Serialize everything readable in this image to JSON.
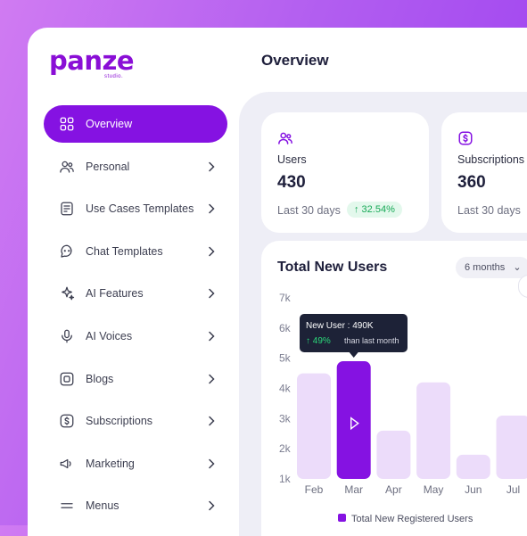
{
  "brand": {
    "logo": "panze",
    "sub": "studio."
  },
  "header": {
    "title": "Overview"
  },
  "sidebar": {
    "items": [
      {
        "label": "Overview",
        "icon": "grid-icon",
        "active": true
      },
      {
        "label": "Personal",
        "icon": "users-icon"
      },
      {
        "label": "Use Cases Templates",
        "icon": "template-icon"
      },
      {
        "label": "Chat Templates",
        "icon": "chat-icon"
      },
      {
        "label": "AI Features",
        "icon": "sparkle-icon"
      },
      {
        "label": "AI Voices",
        "icon": "microphone-icon"
      },
      {
        "label": "Blogs",
        "icon": "blog-icon"
      },
      {
        "label": "Subscriptions",
        "icon": "dollar-icon"
      },
      {
        "label": "Marketing",
        "icon": "megaphone-icon"
      },
      {
        "label": "Menus",
        "icon": "menu-icon"
      }
    ]
  },
  "stats": [
    {
      "label": "Users",
      "value": "430",
      "period": "Last 30 days",
      "change": "↑ 32.54%",
      "icon": "users-icon"
    },
    {
      "label": "Subscriptions",
      "value": "360",
      "period": "Last 30 days",
      "icon": "dollar-icon"
    }
  ],
  "colors": {
    "accent": "#8512e2",
    "bar": "#ecdcfa",
    "positive": "#18a957"
  },
  "chart_data": {
    "type": "bar",
    "title": "Total New Users",
    "range": "6 months",
    "categories": [
      "Feb",
      "Mar",
      "Apr",
      "May",
      "Jun",
      "Jul"
    ],
    "series": [
      {
        "name": "Total New Registered Users",
        "values": [
          4.5,
          4.9,
          2.6,
          4.2,
          1.8,
          3.1
        ]
      }
    ],
    "highlight_index": 1,
    "y_ticks": [
      "7k",
      "6k",
      "5k",
      "4k",
      "3k",
      "2k",
      "1k"
    ],
    "ylim": [
      1,
      7
    ],
    "tooltip": {
      "title": "New User : 490K",
      "change": "↑ 49%",
      "note": "than last month"
    }
  }
}
